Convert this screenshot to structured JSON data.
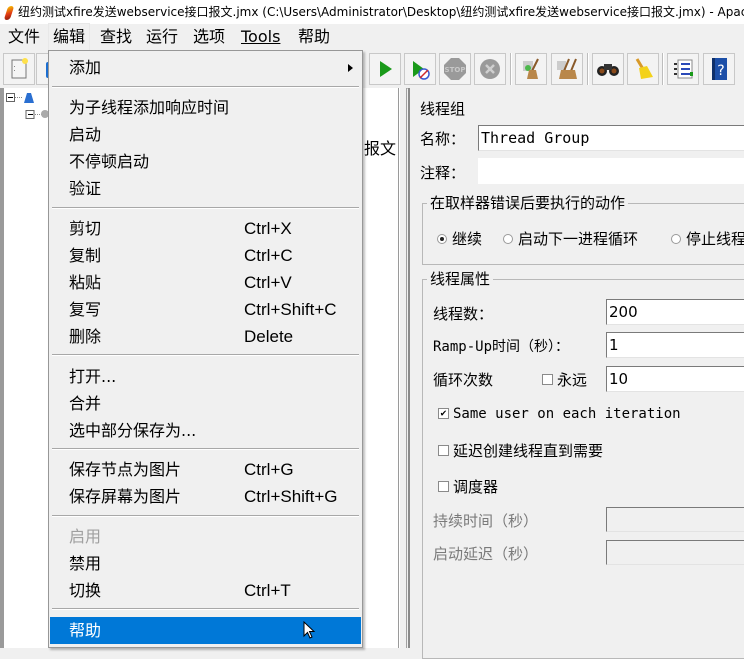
{
  "window": {
    "title": "纽约测试xfire发送webservice接口报文.jmx (C:\\Users\\Administrator\\Desktop\\纽约测试xfire发送webservice接口报文.jmx) - Apache JMeter"
  },
  "menubar": {
    "items": [
      {
        "label": "文件"
      },
      {
        "label": "编辑",
        "active": true
      },
      {
        "label": "查找"
      },
      {
        "label": "运行"
      },
      {
        "label": "选项"
      },
      {
        "label": "Tools",
        "mnemonic": "T"
      },
      {
        "label": "帮助"
      }
    ]
  },
  "toolbar": {
    "buttons": [
      {
        "icon": "new-file-icon"
      },
      {
        "icon": "templates-icon"
      },
      {
        "icon": "start-icon"
      },
      {
        "icon": "start-no-pauses-icon"
      },
      {
        "icon": "stop-icon",
        "label": "STOP",
        "disabled": true
      },
      {
        "icon": "shutdown-icon",
        "disabled": true
      },
      {
        "icon": "clear-icon"
      },
      {
        "icon": "clear-all-icon"
      },
      {
        "icon": "search-binoculars-icon"
      },
      {
        "icon": "reset-search-broom-icon"
      },
      {
        "icon": "function-helper-list-icon"
      },
      {
        "icon": "help-book-icon",
        "label": "?"
      }
    ]
  },
  "tree": {
    "partial_text": "报文"
  },
  "edit_menu": {
    "items": [
      {
        "type": "submenu",
        "label": "添加"
      },
      {
        "type": "separator"
      },
      {
        "label": "为子线程添加响应时间"
      },
      {
        "label": "启动"
      },
      {
        "label": "不停顿启动"
      },
      {
        "label": "验证"
      },
      {
        "type": "separator"
      },
      {
        "label": "剪切",
        "shortcut": "Ctrl+X"
      },
      {
        "label": "复制",
        "shortcut": "Ctrl+C"
      },
      {
        "label": "粘贴",
        "shortcut": "Ctrl+V"
      },
      {
        "label": "复写",
        "shortcut": "Ctrl+Shift+C"
      },
      {
        "label": "删除",
        "shortcut": "Delete"
      },
      {
        "type": "separator"
      },
      {
        "label": "打开..."
      },
      {
        "label": "合并"
      },
      {
        "label": "选中部分保存为..."
      },
      {
        "type": "separator"
      },
      {
        "label": "保存节点为图片",
        "shortcut": "Ctrl+G"
      },
      {
        "label": "保存屏幕为图片",
        "shortcut": "Ctrl+Shift+G"
      },
      {
        "type": "separator"
      },
      {
        "label": "启用",
        "disabled": true
      },
      {
        "label": "禁用"
      },
      {
        "label": "切换",
        "shortcut": "Ctrl+T"
      },
      {
        "type": "separator"
      },
      {
        "label": "帮助",
        "selected": true
      }
    ]
  },
  "thread_group": {
    "header": "线程组",
    "name_label": "名称：",
    "name_value": "Thread Group",
    "comment_label": "注释：",
    "comment_value": "",
    "error_action": {
      "legend": "在取样器错误后要执行的动作",
      "options": [
        {
          "label": "继续",
          "selected": true
        },
        {
          "label": "启动下一进程循环",
          "selected": false
        },
        {
          "label": "停止线程",
          "selected": false
        }
      ]
    },
    "properties": {
      "legend": "线程属性",
      "threads_label": "线程数：",
      "threads_value": "200",
      "rampup_label": "Ramp-Up时间（秒）：",
      "rampup_value": "1",
      "loop_label": "循环次数",
      "forever_label": "永远",
      "forever_checked": false,
      "loop_value": "10",
      "same_user_label": "Same user on each iteration",
      "same_user_checked": true,
      "delay_label": "延迟创建线程直到需要",
      "delay_checked": false,
      "scheduler_label": "调度器",
      "scheduler_checked": false,
      "duration_label": "持续时间（秒）",
      "duration_value": "",
      "startup_delay_label": "启动延迟（秒）",
      "startup_delay_value": ""
    }
  },
  "colors": {
    "selection": "#0078d7",
    "menu_bg": "#f0f0f0",
    "start_green": "#1a9a1a"
  }
}
